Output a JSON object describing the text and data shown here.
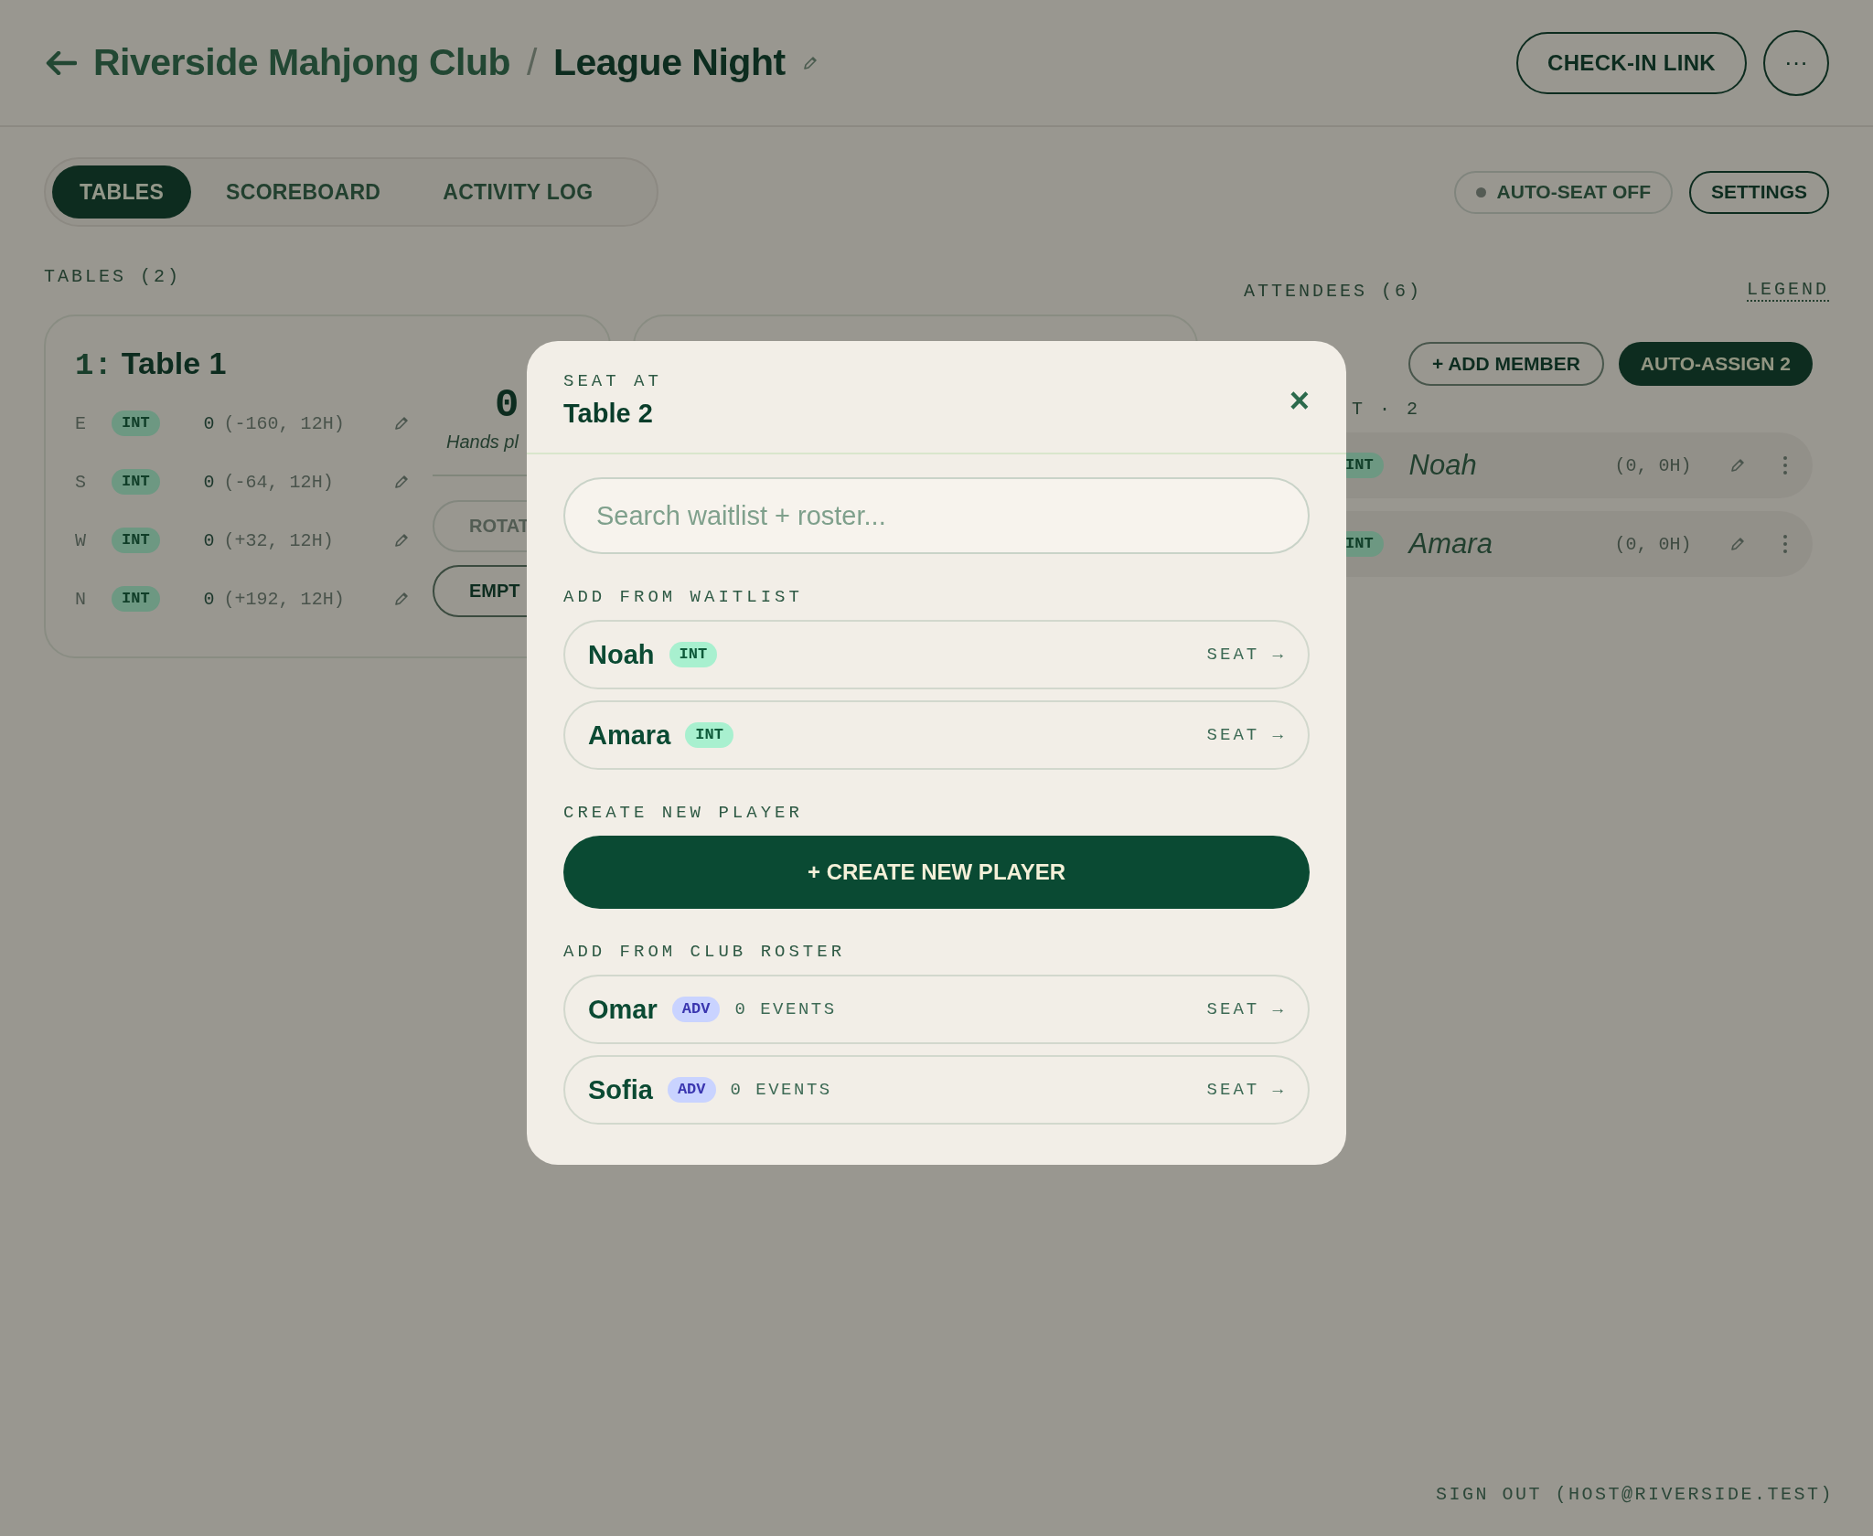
{
  "header": {
    "breadcrumb_parent": "Riverside Mahjong Club",
    "separator": "/",
    "title": "League Night",
    "check_in": "CHECK-IN LINK",
    "more": "···"
  },
  "tabs": [
    {
      "label": "TABLES",
      "selected": true
    },
    {
      "label": "SCOREBOARD",
      "selected": false
    },
    {
      "label": "ACTIVITY LOG",
      "selected": false
    }
  ],
  "toolbar": {
    "auto_seat": {
      "label": "AUTO-SEAT OFF",
      "on": false
    },
    "settings": "SETTINGS"
  },
  "tables": {
    "heading": "TABLES (2)",
    "card": {
      "number": "1:",
      "title": "Table 1",
      "seats": [
        {
          "wind": "E",
          "badge": {
            "label": "INT"
          },
          "points": "0",
          "detail": "(-160, 12H)"
        },
        {
          "wind": "S",
          "badge": {
            "label": "INT"
          },
          "points": "0",
          "detail": "(-64, 12H)"
        },
        {
          "wind": "W",
          "badge": {
            "label": "INT"
          },
          "points": "0",
          "detail": "(+32, 12H)"
        },
        {
          "wind": "N",
          "badge": {
            "label": "INT"
          },
          "points": "0",
          "detail": "(+192, 12H)"
        }
      ],
      "hands": "0",
      "hands_label": "Hands pl",
      "buttons": [
        {
          "label": "ROTAT",
          "disabled": true
        },
        {
          "label": "EMPT",
          "disabled": false
        }
      ]
    }
  },
  "attendees": {
    "heading": "ATTENDEES (6)",
    "legend": "LEGEND",
    "add_member": "+ ADD MEMBER",
    "auto_assign": "AUTO-ASSIGN 2",
    "waitlist_label": "T · 2",
    "rows": [
      {
        "badge": {
          "label": "INT"
        },
        "name": "Noah",
        "stats": "(0, 0H)"
      },
      {
        "badge": {
          "label": "INT"
        },
        "name": "Amara",
        "stats": "(0, 0H)"
      }
    ]
  },
  "modal": {
    "eyebrow": "SEAT AT",
    "title": "Table 2",
    "close": "×",
    "search_placeholder": "Search waitlist + roster...",
    "sections": [
      {
        "kind": "list",
        "heading": "ADD FROM WAITLIST",
        "players": [
          {
            "name": "Noah",
            "badge": {
              "label": "INT",
              "color": "#a8f0cf"
            },
            "action": "SEAT →"
          },
          {
            "name": "Amara",
            "badge": {
              "label": "INT",
              "color": "#a8f0cf"
            },
            "action": "SEAT →"
          }
        ]
      },
      {
        "kind": "create",
        "heading": "CREATE NEW PLAYER",
        "button": "+ CREATE NEW PLAYER"
      },
      {
        "kind": "list",
        "heading": "ADD FROM CLUB ROSTER",
        "players": [
          {
            "name": "Omar",
            "badge": {
              "label": "ADV",
              "color": "#c9d3ff"
            },
            "events": "0 EVENTS",
            "action": "SEAT →"
          },
          {
            "name": "Sofia",
            "badge": {
              "label": "ADV",
              "color": "#c9d3ff"
            },
            "events": "0 EVENTS",
            "action": "SEAT →"
          }
        ]
      }
    ]
  },
  "footer": {
    "sign_out": "SIGN OUT (HOST@RIVERSIDE.TEST)"
  }
}
